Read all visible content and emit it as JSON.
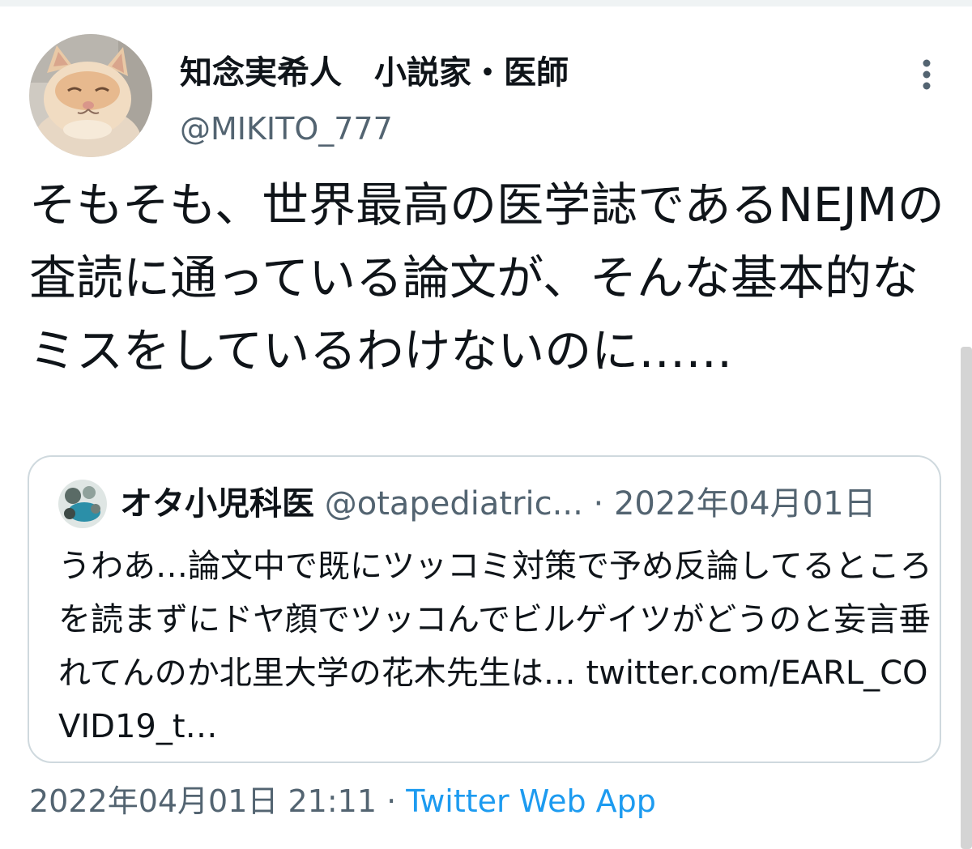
{
  "tweet": {
    "display_name": "知念実希人　小説家・医師",
    "handle": "@MIKITO_777",
    "text": "そもそも、世界最高の医学誌であるNEJMの査読に通っている論文が、そんな基本的なミスをしているわけないのに……",
    "timestamp": "2022年04月01日 21:11",
    "separator": "·",
    "source": "Twitter Web App"
  },
  "quoted_tweet": {
    "name": "オタ小児科医",
    "handle": "@otapediatric...",
    "separator": "·",
    "date": "2022年04月01日",
    "text": "うわあ…論文中で既にツッコミ対策で予め反論してるところを読まずにドヤ顔でツッコんでビルゲイツがどうのと妄言垂れてんのか北里大学の花木先生は… twitter.com/EARL_COVID19_t…"
  },
  "icons": {
    "more": "more-vertical-icon",
    "avatar": "cat-avatar",
    "quote_avatar": "quote-user-avatar"
  },
  "colors": {
    "text_primary": "#0f1419",
    "text_secondary": "#536471",
    "link": "#1d9bf0",
    "border": "#cfd9de"
  }
}
